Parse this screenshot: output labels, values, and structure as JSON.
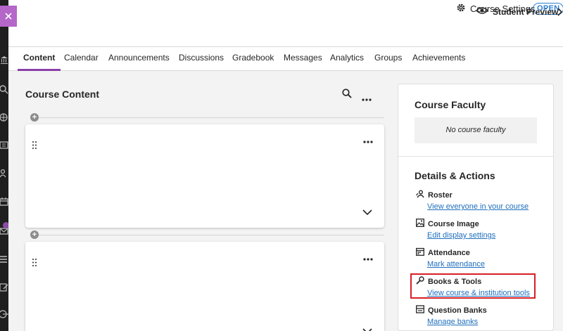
{
  "header": {
    "course_settings_label": "Course Settings",
    "status_badge": "OPEN"
  },
  "tabs": [
    {
      "label": "Content",
      "active": true
    },
    {
      "label": "Calendar"
    },
    {
      "label": "Announcements"
    },
    {
      "label": "Discussions"
    },
    {
      "label": "Gradebook"
    },
    {
      "label": "Messages"
    },
    {
      "label": "Analytics"
    },
    {
      "label": "Groups"
    },
    {
      "label": "Achievements"
    }
  ],
  "student_preview_label": "Student Preview",
  "content": {
    "title": "Course Content"
  },
  "panel": {
    "faculty_heading": "Course Faculty",
    "no_faculty": "No course faculty",
    "details_heading": "Details & Actions",
    "actions": [
      {
        "title": "Roster",
        "link": "View everyone in your course",
        "icon": "roster-icon"
      },
      {
        "title": "Course Image",
        "link": "Edit display settings",
        "icon": "image-icon"
      },
      {
        "title": "Attendance",
        "link": "Mark attendance",
        "icon": "calendar-icon"
      },
      {
        "title": "Books & Tools",
        "link": "View course & institution tools",
        "icon": "wrench-icon"
      },
      {
        "title": "Question Banks",
        "link": "Manage banks",
        "icon": "bank-icon"
      }
    ]
  },
  "colors": {
    "accent": "#8a3fa8",
    "link": "#1e6fbd",
    "highlight": "#d61f26",
    "close_button": "#b566c9"
  }
}
